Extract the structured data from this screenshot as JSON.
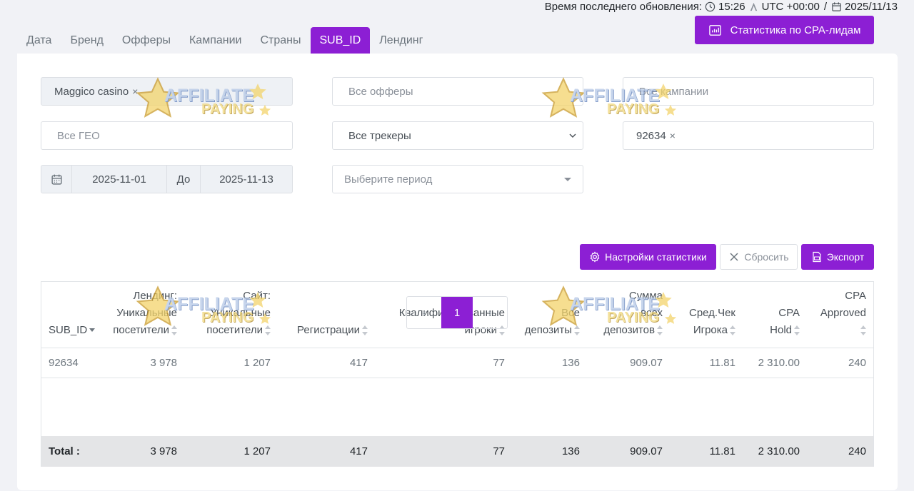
{
  "header": {
    "update_label": "Время последнего обновления:",
    "time": "15:26",
    "timezone": "UTC +00:00",
    "separator": "/",
    "date": "2025/11/13"
  },
  "tabs": [
    {
      "label": "Дата",
      "active": false
    },
    {
      "label": "Бренд",
      "active": false
    },
    {
      "label": "Офферы",
      "active": false
    },
    {
      "label": "Кампании",
      "active": false
    },
    {
      "label": "Страны",
      "active": false
    },
    {
      "label": "SUB_ID",
      "active": true
    },
    {
      "label": "Лендинг",
      "active": false
    }
  ],
  "cpa_button": {
    "label": "Статистика по CPA-лидам",
    "icon": "chart-icon"
  },
  "filters": {
    "brand": {
      "value": "Maggico casino",
      "remove": "×"
    },
    "offers": {
      "placeholder": "Все офферы"
    },
    "campaigns": {
      "placeholder": "Все кампании"
    },
    "geo": {
      "placeholder": "Все ГЕО"
    },
    "trackers": {
      "value": "Все трекеры"
    },
    "subid": {
      "value": "92634",
      "remove": "×"
    },
    "date_from": "2025-11-01",
    "date_to_label": "До",
    "date_to": "2025-11-13",
    "period": {
      "placeholder": "Выберите период"
    }
  },
  "actions": {
    "settings": "Настройки статистики",
    "reset": "Сбросить",
    "export": "Экспорт"
  },
  "table": {
    "columns": [
      [
        "SUB_ID"
      ],
      [
        "Лендинг:",
        "Уникальные",
        "посетители"
      ],
      [
        "Сайт:",
        "Уникальные",
        "посетители"
      ],
      [
        "Регистрации"
      ],
      [
        "Квалифицированные",
        "игроки"
      ],
      [
        "Все",
        "депозиты"
      ],
      [
        "Сумма",
        "всех",
        "депозитов"
      ],
      [
        "Сред.Чек",
        "Игрока"
      ],
      [
        "CPA",
        "Hold"
      ],
      [
        "CPA",
        "Approved"
      ]
    ],
    "rows": [
      [
        "92634",
        "3 978",
        "1 207",
        "417",
        "77",
        "136",
        "909.07",
        "11.81",
        "2 310.00",
        "240"
      ]
    ],
    "total": [
      "Total :",
      "3 978",
      "1 207",
      "417",
      "77",
      "136",
      "909.07",
      "11.81",
      "2 310.00",
      "240"
    ]
  },
  "pagination": {
    "prev": "‹",
    "current": "1",
    "next": "›"
  },
  "watermark": {
    "line1": "AFFILIATE",
    "line2": "PAYING"
  },
  "colors": {
    "accent": "#8c1fd4",
    "background": "#f1f2f6"
  }
}
